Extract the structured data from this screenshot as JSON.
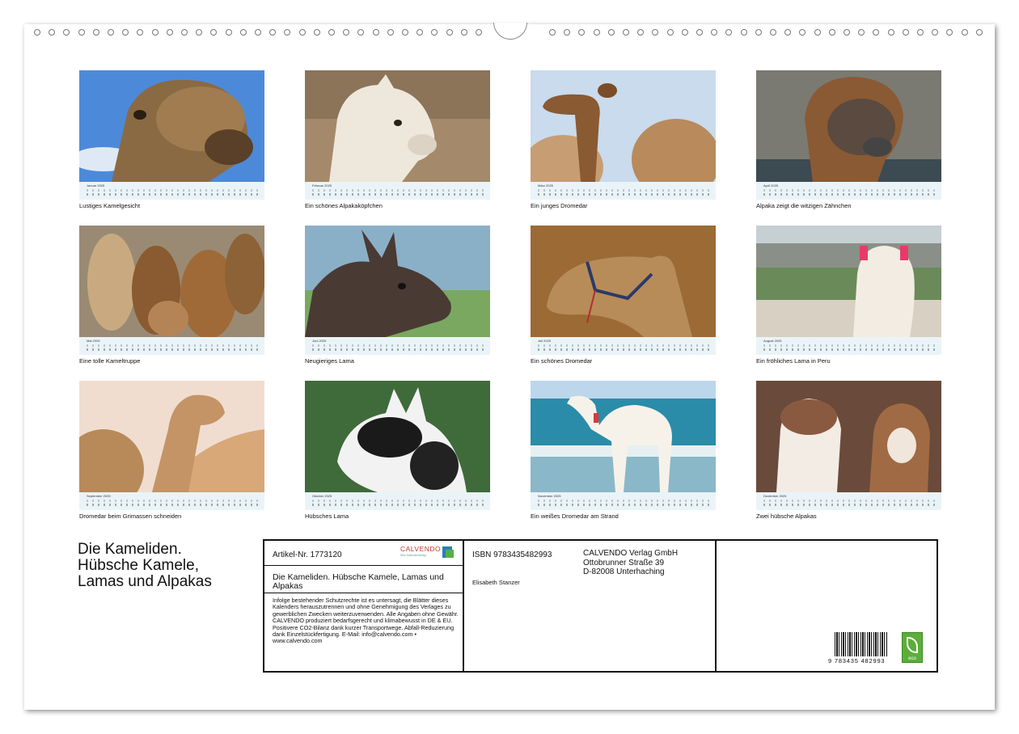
{
  "months": [
    {
      "name": "Januar 2025",
      "caption": "Lustiges Kamelgesicht"
    },
    {
      "name": "Februar 2025",
      "caption": "Ein schönes Alpakaköpfchen"
    },
    {
      "name": "März 2025",
      "caption": "Ein junges Dromedar"
    },
    {
      "name": "April 2025",
      "caption": "Alpaka zeigt die witzigen Zähnchen"
    },
    {
      "name": "Mai 2025",
      "caption": "Eine tolle Kameltruppe"
    },
    {
      "name": "Juni 2025",
      "caption": "Neugieriges Lama"
    },
    {
      "name": "Juli 2025",
      "caption": "Ein schönes Dromedar"
    },
    {
      "name": "August 2025",
      "caption": "Ein fröhliches Lama in Peru"
    },
    {
      "name": "September 2025",
      "caption": "Dromedar beim Grimassen schneiden"
    },
    {
      "name": "Oktober 2025",
      "caption": "Hübsches Lama"
    },
    {
      "name": "November 2025",
      "caption": "Ein weißes Dromedar am Strand"
    },
    {
      "name": "Dezember 2025",
      "caption": "Zwei hübsche Alpakas"
    }
  ],
  "title_lines": [
    "Die Kameliden.",
    "Hübsche Kamele,",
    "Lamas und Alpakas"
  ],
  "info": {
    "article": "Artikel-Nr. 1773120",
    "logo_name": "CALVENDO",
    "logo_sub": "Sein Kalenderverlag",
    "product_title": "Die Kameliden. Hübsche Kamele, Lamas und Alpakas",
    "legal": "Infolge bestehender Schutzrechte ist es untersagt, die Blätter dieses Kalenders herauszutrennen und ohne Genehmigung des Verlages zu gewerblichen Zwecken weiterzuverwenden. Alle Angaben ohne Gewähr. CALVENDO produziert bedarfsgerecht und klimabewusst in DE & EU. Positivere CO2-Bilanz dank kurzer Transportwege. Abfall-Reduzierung dank Einzelstückfertigung. E-Mail: info@calvendo.com • www.calvendo.com",
    "isbn": "ISBN 9783435482993",
    "author": "Elisabeth Stanzer",
    "publisher_lines": [
      "CALVENDO Verlag GmbH",
      "Ottobrunner Straße 39",
      "D-82008 Unterhaching"
    ],
    "barcode_number": "9 783435 482993",
    "eco_label": "eco"
  },
  "colors": {
    "sky": "#4a86d8",
    "sand": "#c9945a",
    "calendar_strip": "#eaf4f8",
    "logo_red": "#c0392b",
    "eco_green": "#5cae3a"
  }
}
